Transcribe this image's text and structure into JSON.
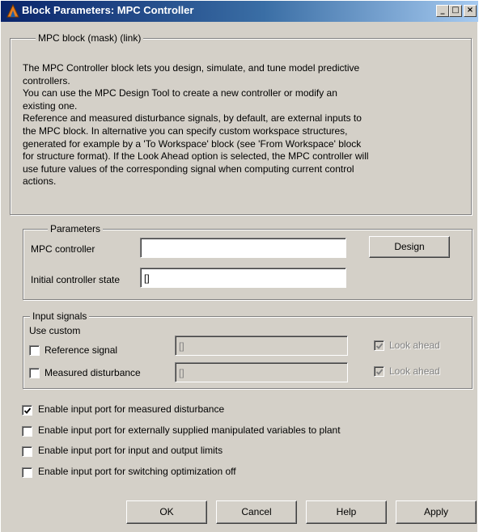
{
  "window": {
    "title": "Block Parameters: MPC Controller",
    "minimize_glyph": "_",
    "maximize_glyph": "□",
    "close_glyph": "×"
  },
  "mask_group": {
    "legend": "MPC block (mask) (link)",
    "lines": [
      "The MPC Controller block lets you design, simulate, and tune model predictive",
      "controllers.",
      "You can use the MPC Design Tool to create a new controller or modify an",
      "existing one.",
      "Reference and measured disturbance signals, by default, are external inputs to",
      "the MPC block. In alternative you can specify custom workspace structures,",
      "generated for example by a 'To Workspace' block (see 'From Workspace' block",
      "for structure format). If the Look Ahead option is selected, the MPC controller will",
      "use future values of the corresponding signal when computing current control",
      "actions."
    ]
  },
  "parameters": {
    "legend": "Parameters",
    "mpc_controller_label": "MPC controller",
    "mpc_controller_value": "",
    "design_button": "Design",
    "initial_state_label": "Initial controller state",
    "initial_state_value": "[]"
  },
  "input_signals": {
    "legend": "Input signals",
    "use_custom_label": "Use custom",
    "reference_label": "Reference signal",
    "reference_checked": false,
    "reference_value": "[]",
    "reference_look_ahead": "Look ahead",
    "measured_label": "Measured disturbance",
    "measured_checked": false,
    "measured_value": "[]",
    "measured_look_ahead": "Look ahead"
  },
  "options": [
    {
      "label": "Enable input port for measured disturbance",
      "checked": true
    },
    {
      "label": "Enable input port for externally supplied manipulated variables to plant",
      "checked": false
    },
    {
      "label": "Enable input port for input and output limits",
      "checked": false
    },
    {
      "label": "Enable input port for switching optimization off",
      "checked": false
    }
  ],
  "buttons": {
    "ok": "OK",
    "cancel": "Cancel",
    "help": "Help",
    "apply": "Apply"
  },
  "colors": {
    "title_gradient_start": "#0a246a",
    "title_gradient_end": "#a6caf0",
    "dialog_face": "#d4d0c8",
    "disabled_text": "#808080"
  },
  "icons": {
    "title": "simulink-block-icon",
    "checkmark": "checkmark-icon"
  }
}
